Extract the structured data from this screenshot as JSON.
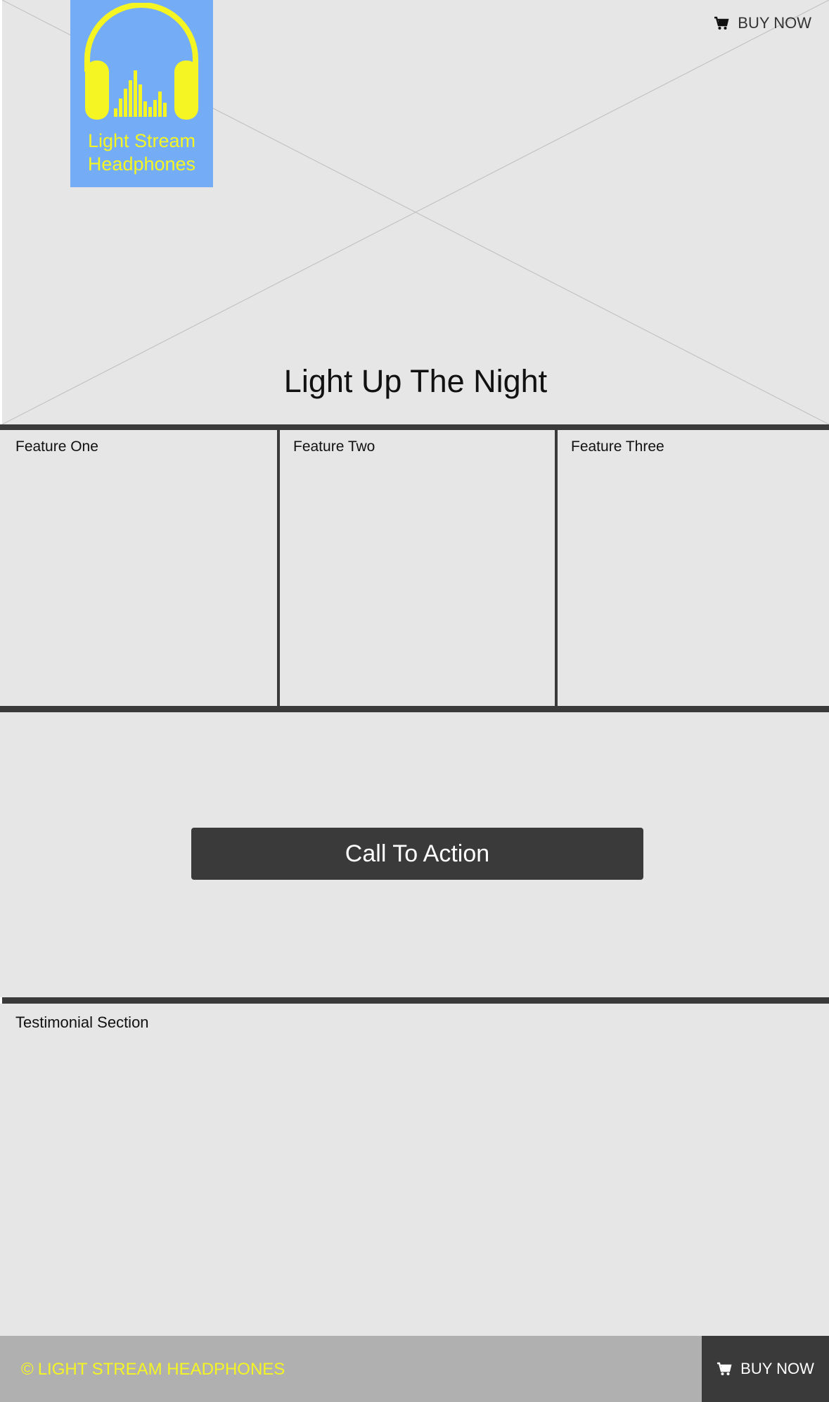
{
  "header": {
    "logo_line1": "Light Stream",
    "logo_line2": "Headphones",
    "buy_label": "BUY NOW"
  },
  "hero": {
    "title": "Light Up The Night"
  },
  "features": [
    {
      "label": "Feature One"
    },
    {
      "label": "Feature Two"
    },
    {
      "label": "Feature Three"
    }
  ],
  "cta": {
    "label": "Call To Action"
  },
  "testimonial": {
    "label": "Testimonial Section"
  },
  "footer": {
    "copyright_symbol": "©",
    "copyright": "LIGHT STREAM HEADPHONES",
    "buy_label": "BUY NOW"
  },
  "colors": {
    "logo_bg": "#74acf6",
    "brand_yellow": "#f5f524",
    "dark": "#3a3a3a",
    "placeholder_bg": "#e6e6e6",
    "footer_bg": "#b0b0b0"
  },
  "icons": [
    "headphones-logo-icon",
    "cart-icon",
    "copyright-icon"
  ]
}
